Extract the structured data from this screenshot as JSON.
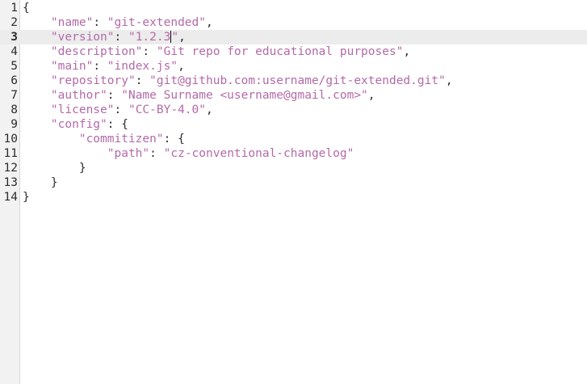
{
  "editor": {
    "current_line": 3,
    "lines": [
      {
        "number": "1",
        "tokens": [
          {
            "t": "pun",
            "v": "{"
          }
        ]
      },
      {
        "number": "2",
        "tokens": [
          {
            "t": "pun",
            "v": "    "
          },
          {
            "t": "str",
            "v": "\"name\""
          },
          {
            "t": "pun",
            "v": ": "
          },
          {
            "t": "str",
            "v": "\"git-extended\""
          },
          {
            "t": "pun",
            "v": ","
          }
        ]
      },
      {
        "number": "3",
        "tokens": [
          {
            "t": "pun",
            "v": "    "
          },
          {
            "t": "str",
            "v": "\"version\""
          },
          {
            "t": "pun",
            "v": ": "
          },
          {
            "t": "str",
            "v": "\"1.2.3"
          },
          {
            "t": "caret",
            "v": ""
          },
          {
            "t": "str",
            "v": "\""
          },
          {
            "t": "pun",
            "v": ","
          }
        ]
      },
      {
        "number": "4",
        "tokens": [
          {
            "t": "pun",
            "v": "    "
          },
          {
            "t": "str",
            "v": "\"description\""
          },
          {
            "t": "pun",
            "v": ": "
          },
          {
            "t": "str",
            "v": "\"Git repo for educational purposes\""
          },
          {
            "t": "pun",
            "v": ","
          }
        ]
      },
      {
        "number": "5",
        "tokens": [
          {
            "t": "pun",
            "v": "    "
          },
          {
            "t": "str",
            "v": "\"main\""
          },
          {
            "t": "pun",
            "v": ": "
          },
          {
            "t": "str",
            "v": "\"index.js\""
          },
          {
            "t": "pun",
            "v": ","
          }
        ]
      },
      {
        "number": "6",
        "tokens": [
          {
            "t": "pun",
            "v": "    "
          },
          {
            "t": "str",
            "v": "\"repository\""
          },
          {
            "t": "pun",
            "v": ": "
          },
          {
            "t": "str",
            "v": "\"git@github.com:username/git-extended.git\""
          },
          {
            "t": "pun",
            "v": ","
          }
        ]
      },
      {
        "number": "7",
        "tokens": [
          {
            "t": "pun",
            "v": "    "
          },
          {
            "t": "str",
            "v": "\"author\""
          },
          {
            "t": "pun",
            "v": ": "
          },
          {
            "t": "str",
            "v": "\"Name Surname <username@gmail.com>\""
          },
          {
            "t": "pun",
            "v": ","
          }
        ]
      },
      {
        "number": "8",
        "tokens": [
          {
            "t": "pun",
            "v": "    "
          },
          {
            "t": "str",
            "v": "\"license\""
          },
          {
            "t": "pun",
            "v": ": "
          },
          {
            "t": "str",
            "v": "\"CC-BY-4.0\""
          },
          {
            "t": "pun",
            "v": ","
          }
        ]
      },
      {
        "number": "9",
        "tokens": [
          {
            "t": "pun",
            "v": "    "
          },
          {
            "t": "str",
            "v": "\"config\""
          },
          {
            "t": "pun",
            "v": ": {"
          }
        ]
      },
      {
        "number": "10",
        "tokens": [
          {
            "t": "pun",
            "v": "        "
          },
          {
            "t": "str",
            "v": "\"commitizen\""
          },
          {
            "t": "pun",
            "v": ": {"
          }
        ]
      },
      {
        "number": "11",
        "tokens": [
          {
            "t": "pun",
            "v": "            "
          },
          {
            "t": "str",
            "v": "\"path\""
          },
          {
            "t": "pun",
            "v": ": "
          },
          {
            "t": "str",
            "v": "\"cz-conventional-changelog\""
          }
        ]
      },
      {
        "number": "12",
        "tokens": [
          {
            "t": "pun",
            "v": "        }"
          }
        ]
      },
      {
        "number": "13",
        "tokens": [
          {
            "t": "pun",
            "v": "    }"
          }
        ]
      },
      {
        "number": "14",
        "tokens": [
          {
            "t": "pun",
            "v": "}"
          }
        ]
      }
    ]
  },
  "colors": {
    "string": "#b36aa8",
    "text": "#2e2e2e",
    "gutter_bg": "#f2f2f2",
    "current_line_bg": "#ececec"
  }
}
